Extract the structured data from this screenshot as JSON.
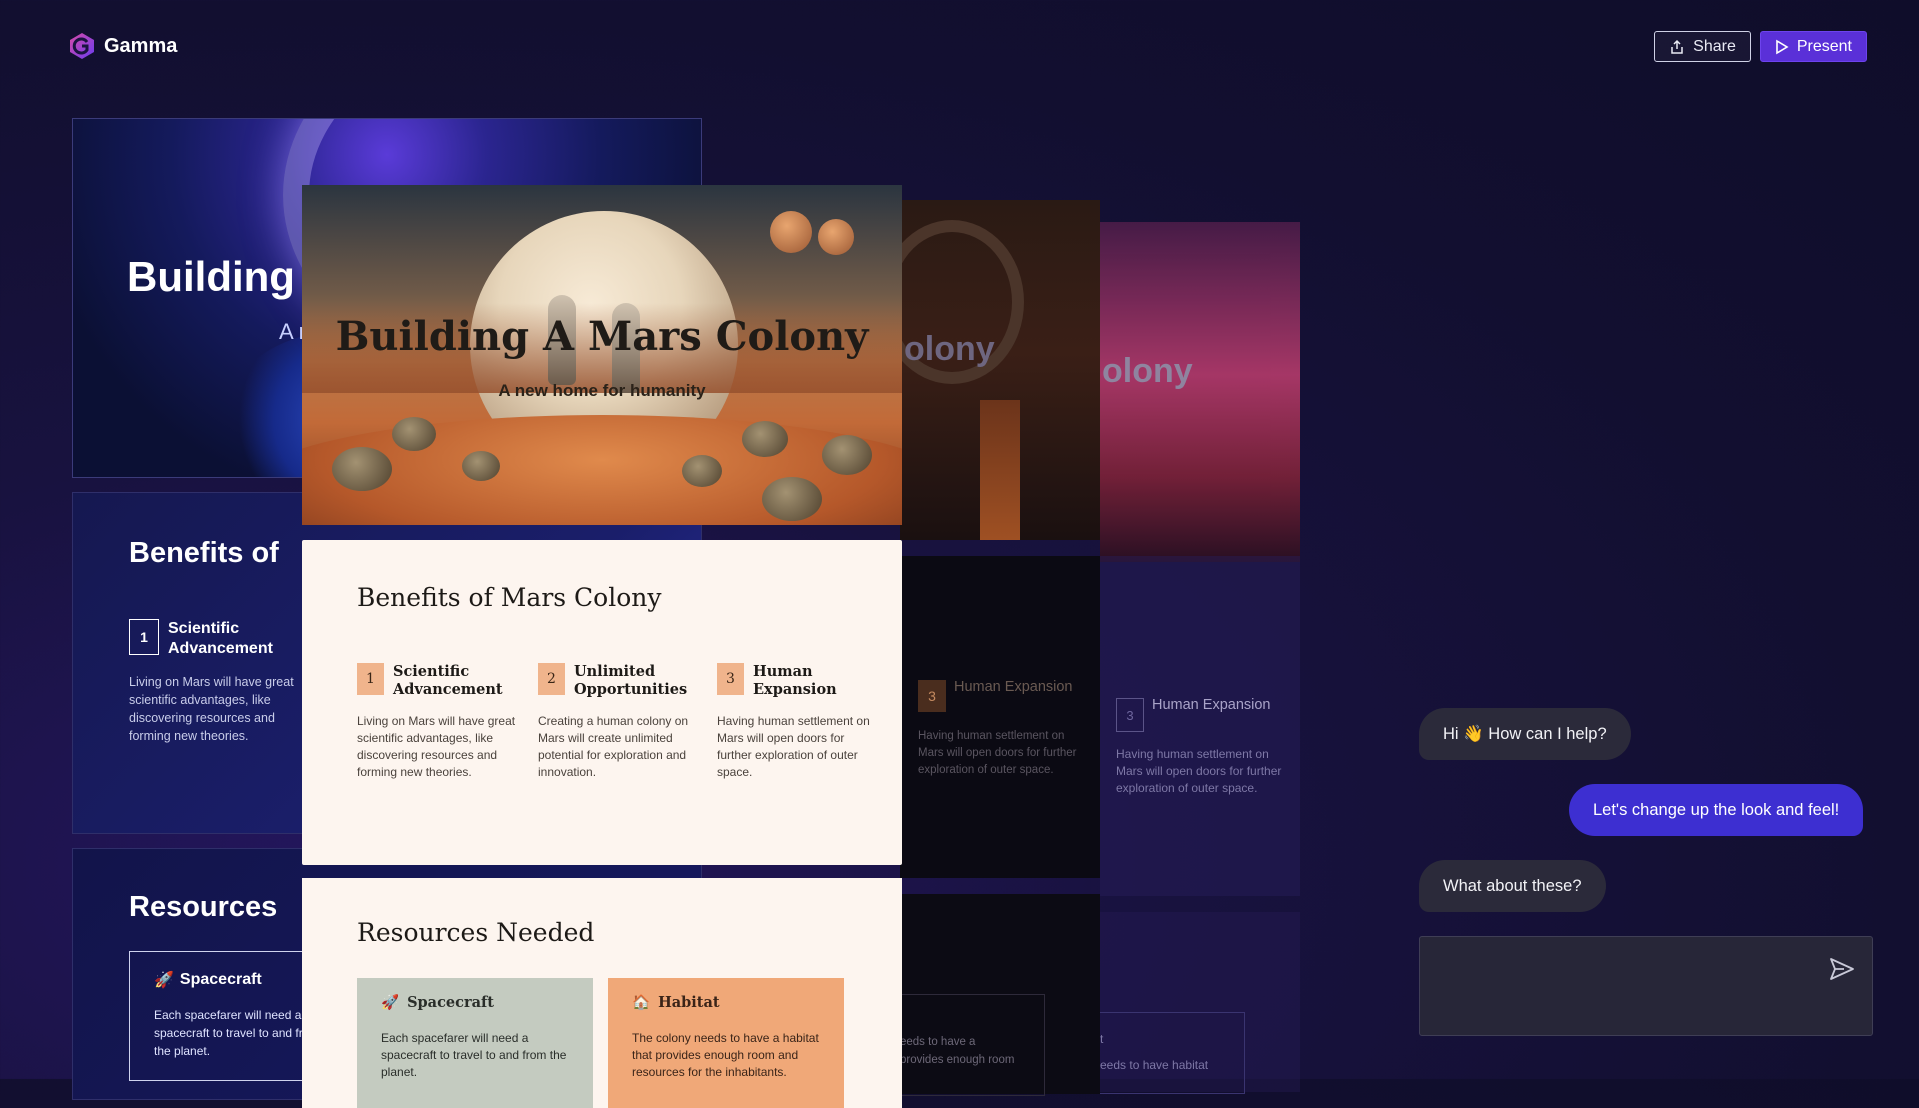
{
  "app": {
    "name": "Gamma"
  },
  "toolbar": {
    "share_label": "Share",
    "present_label": "Present"
  },
  "bg_decks": {
    "title_deck": {
      "title": "Building",
      "subtitle": "A n"
    },
    "benefits_deck": {
      "title": "Benefits of",
      "num": "1",
      "head": "Scientific Advancement",
      "body": "Living on Mars will have great scientific advantages, like discovering resources and forming new theories."
    },
    "resources_deck": {
      "title": "Resources",
      "card_head": "Spacecraft",
      "card_body": "Each spacefarer will need a spacecraft to travel to and from the planet."
    },
    "dark_deck": {
      "title": "olony",
      "num": "3",
      "head": "Human Expansion",
      "body": "Having human settlement on Mars will open doors for further exploration of outer space.",
      "res_line1": "eeds to have a",
      "res_line2": "provides enough room"
    },
    "pink_deck": {
      "title": "olony",
      "num": "3",
      "head": "Human Expansion",
      "body": "Having human settlement on Mars will open doors for further exploration of outer space.",
      "res_line1": "t",
      "res_line2": "eeds to have habitat"
    }
  },
  "preview": {
    "hero": {
      "title": "Building A Mars Colony",
      "subtitle": "A new home for humanity"
    },
    "benefits": {
      "title": "Benefits of Mars Colony",
      "items": [
        {
          "num": "1",
          "head": "Scientific Advancement",
          "body": "Living on Mars will have great scientific advantages, like discovering resources and forming new theories."
        },
        {
          "num": "2",
          "head": "Unlimited Opportunities",
          "body": "Creating a human colony on Mars will create unlimited potential for exploration and innovation."
        },
        {
          "num": "3",
          "head": "Human Expansion",
          "body": "Having human settlement on Mars will open doors for further exploration of outer space."
        }
      ]
    },
    "resources": {
      "title": "Resources Needed",
      "cards": [
        {
          "head": "Spacecraft",
          "icon": "rocket-icon",
          "body": "Each spacefarer will need a spacecraft to travel to and from the planet."
        },
        {
          "head": "Habitat",
          "icon": "house-icon",
          "body": "The colony needs to have a habitat that provides enough room and resources for the inhabitants."
        }
      ]
    }
  },
  "chat": {
    "messages": [
      {
        "role": "ai",
        "text": "Hi 👋 How can I help?"
      },
      {
        "role": "user",
        "text": "Let's change up the look and feel!"
      },
      {
        "role": "ai",
        "text": "What about these?"
      }
    ],
    "input_value": ""
  },
  "colors": {
    "accent": "#5a30d8",
    "user_bubble": "#3d2fd1",
    "ai_bubble": "#2b2a3a",
    "card_bg": "#fdf5ef",
    "number_badge": "#f0b48c"
  }
}
